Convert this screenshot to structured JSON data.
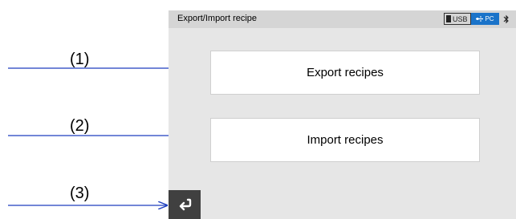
{
  "screen": {
    "title": "Export/Import recipe",
    "status": {
      "usb_label": "USB",
      "pc_label": "PC",
      "bluetooth_icon": "bluetooth-icon"
    },
    "buttons": {
      "export_label": "Export recipes",
      "import_label": "Import recipes",
      "back_icon": "return-arrow-icon"
    }
  },
  "callouts": [
    "(1)",
    "(2)",
    "(3)"
  ],
  "colors": {
    "screen_bg": "#e6e6e6",
    "title_bar_bg": "#d5d5d5",
    "arrow": "#1f3fbf",
    "pc_badge": "#1a73c9",
    "back_button": "#404040"
  }
}
